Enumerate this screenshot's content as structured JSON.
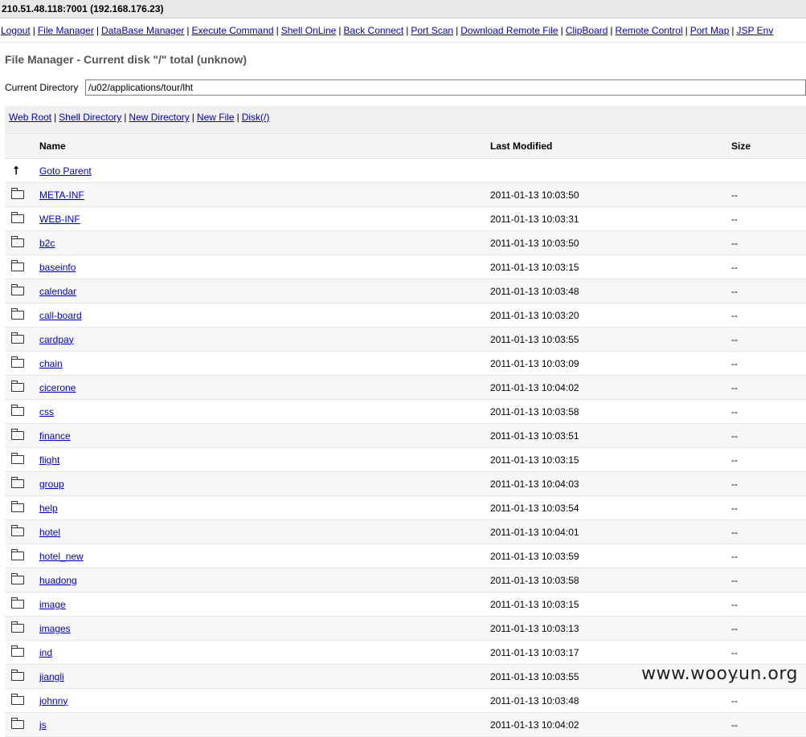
{
  "topbar": {
    "host": "210.51.48.118:7001 (192.168.176.23)"
  },
  "nav": [
    "Logout",
    "File Manager",
    "DataBase Manager",
    "Execute Command",
    "Shell OnLine",
    "Back Connect",
    "Port Scan",
    "Download Remote File",
    "ClipBoard",
    "Remote Control",
    "Port Map",
    "JSP Env"
  ],
  "page": {
    "title": "File Manager - Current disk \"/\" total (unknow)"
  },
  "current_dir": {
    "label": "Current Directory",
    "value": "/u02/applications/tour/lht"
  },
  "toolbar": [
    "Web Root",
    "Shell Directory",
    "New Directory",
    "New File",
    "Disk(/)"
  ],
  "table": {
    "headers": {
      "name": "Name",
      "modified": "Last Modified",
      "size": "Size"
    },
    "parent": {
      "icon": "up-arrow-icon",
      "glyph": "⭡",
      "label": "Goto Parent"
    },
    "rows": [
      {
        "name": "META-INF",
        "modified": "2011-01-13 10:03:50",
        "size": "--"
      },
      {
        "name": "WEB-INF",
        "modified": "2011-01-13 10:03:31",
        "size": "--"
      },
      {
        "name": "b2c",
        "modified": "2011-01-13 10:03:50",
        "size": "--"
      },
      {
        "name": "baseinfo",
        "modified": "2011-01-13 10:03:15",
        "size": "--"
      },
      {
        "name": "calendar",
        "modified": "2011-01-13 10:03:48",
        "size": "--"
      },
      {
        "name": "call-board",
        "modified": "2011-01-13 10:03:20",
        "size": "--"
      },
      {
        "name": "cardpay",
        "modified": "2011-01-13 10:03:55",
        "size": "--"
      },
      {
        "name": "chain",
        "modified": "2011-01-13 10:03:09",
        "size": "--"
      },
      {
        "name": "cicerone",
        "modified": "2011-01-13 10:04:02",
        "size": "--"
      },
      {
        "name": "css",
        "modified": "2011-01-13 10:03:58",
        "size": "--"
      },
      {
        "name": "finance",
        "modified": "2011-01-13 10:03:51",
        "size": "--"
      },
      {
        "name": "flight",
        "modified": "2011-01-13 10:03:15",
        "size": "--"
      },
      {
        "name": "group",
        "modified": "2011-01-13 10:04:03",
        "size": "--"
      },
      {
        "name": "help",
        "modified": "2011-01-13 10:03:54",
        "size": "--"
      },
      {
        "name": "hotel",
        "modified": "2011-01-13 10:04:01",
        "size": "--"
      },
      {
        "name": "hotel_new",
        "modified": "2011-01-13 10:03:59",
        "size": "--"
      },
      {
        "name": "huadong",
        "modified": "2011-01-13 10:03:58",
        "size": "--"
      },
      {
        "name": "image",
        "modified": "2011-01-13 10:03:15",
        "size": "--"
      },
      {
        "name": "images",
        "modified": "2011-01-13 10:03:13",
        "size": "--"
      },
      {
        "name": "ind",
        "modified": "2011-01-13 10:03:17",
        "size": "--"
      },
      {
        "name": "jiangli",
        "modified": "2011-01-13 10:03:55",
        "size": "--"
      },
      {
        "name": "johnny",
        "modified": "2011-01-13 10:03:48",
        "size": "--"
      },
      {
        "name": "js",
        "modified": "2011-01-13 10:04:02",
        "size": "--"
      }
    ]
  },
  "watermark": "www.wooyun.org"
}
